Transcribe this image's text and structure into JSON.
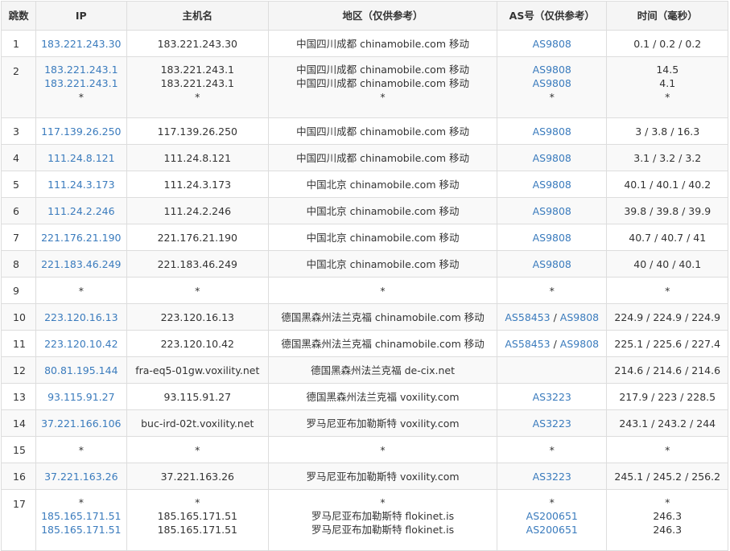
{
  "headers": [
    "跳数",
    "IP",
    "主机名",
    "地区（仅供参考）",
    "AS号（仅供参考）",
    "时间（毫秒）"
  ],
  "rows": [
    {
      "hop": "1",
      "ip": [
        "183.221.243.30"
      ],
      "host": [
        "183.221.243.30"
      ],
      "region": [
        "中国四川成都 chinamobile.com 移动"
      ],
      "as": [
        [
          "AS9808"
        ]
      ],
      "time": [
        "0.1 / 0.2 / 0.2"
      ]
    },
    {
      "hop": "2",
      "ip": [
        "183.221.243.1",
        "183.221.243.1",
        "*"
      ],
      "host": [
        "183.221.243.1",
        "183.221.243.1",
        "*"
      ],
      "region": [
        "中国四川成都 chinamobile.com 移动",
        "中国四川成都 chinamobile.com 移动",
        "*"
      ],
      "as": [
        [
          "AS9808"
        ],
        [
          "AS9808"
        ],
        [
          "*"
        ]
      ],
      "time": [
        "14.5",
        "4.1",
        "*"
      ]
    },
    {
      "hop": "3",
      "ip": [
        "117.139.26.250"
      ],
      "host": [
        "117.139.26.250"
      ],
      "region": [
        "中国四川成都 chinamobile.com 移动"
      ],
      "as": [
        [
          "AS9808"
        ]
      ],
      "time": [
        "3 / 3.8 / 16.3"
      ]
    },
    {
      "hop": "4",
      "ip": [
        "111.24.8.121"
      ],
      "host": [
        "111.24.8.121"
      ],
      "region": [
        "中国四川成都 chinamobile.com 移动"
      ],
      "as": [
        [
          "AS9808"
        ]
      ],
      "time": [
        "3.1 / 3.2 / 3.2"
      ]
    },
    {
      "hop": "5",
      "ip": [
        "111.24.3.173"
      ],
      "host": [
        "111.24.3.173"
      ],
      "region": [
        "中国北京 chinamobile.com 移动"
      ],
      "as": [
        [
          "AS9808"
        ]
      ],
      "time": [
        "40.1 / 40.1 / 40.2"
      ]
    },
    {
      "hop": "6",
      "ip": [
        "111.24.2.246"
      ],
      "host": [
        "111.24.2.246"
      ],
      "region": [
        "中国北京 chinamobile.com 移动"
      ],
      "as": [
        [
          "AS9808"
        ]
      ],
      "time": [
        "39.8 / 39.8 / 39.9"
      ]
    },
    {
      "hop": "7",
      "ip": [
        "221.176.21.190"
      ],
      "host": [
        "221.176.21.190"
      ],
      "region": [
        "中国北京 chinamobile.com 移动"
      ],
      "as": [
        [
          "AS9808"
        ]
      ],
      "time": [
        "40.7 / 40.7 / 41"
      ]
    },
    {
      "hop": "8",
      "ip": [
        "221.183.46.249"
      ],
      "host": [
        "221.183.46.249"
      ],
      "region": [
        "中国北京 chinamobile.com 移动"
      ],
      "as": [
        [
          "AS9808"
        ]
      ],
      "time": [
        "40 / 40 / 40.1"
      ]
    },
    {
      "hop": "9",
      "ip": [
        "*"
      ],
      "host": [
        "*"
      ],
      "region": [
        "*"
      ],
      "as": [
        [
          "*"
        ]
      ],
      "time": [
        "*"
      ]
    },
    {
      "hop": "10",
      "ip": [
        "223.120.16.13"
      ],
      "host": [
        "223.120.16.13"
      ],
      "region": [
        "德国黑森州法兰克福 chinamobile.com 移动"
      ],
      "as": [
        [
          "AS58453",
          "AS9808"
        ]
      ],
      "time": [
        "224.9 / 224.9 / 224.9"
      ]
    },
    {
      "hop": "11",
      "ip": [
        "223.120.10.42"
      ],
      "host": [
        "223.120.10.42"
      ],
      "region": [
        "德国黑森州法兰克福 chinamobile.com 移动"
      ],
      "as": [
        [
          "AS58453",
          "AS9808"
        ]
      ],
      "time": [
        "225.1 / 225.6 / 227.4"
      ]
    },
    {
      "hop": "12",
      "ip": [
        "80.81.195.144"
      ],
      "host": [
        "fra-eq5-01gw.voxility.net"
      ],
      "region": [
        "德国黑森州法兰克福 de-cix.net"
      ],
      "as": [
        []
      ],
      "time": [
        "214.6 / 214.6 / 214.6"
      ]
    },
    {
      "hop": "13",
      "ip": [
        "93.115.91.27"
      ],
      "host": [
        "93.115.91.27"
      ],
      "region": [
        "德国黑森州法兰克福 voxility.com"
      ],
      "as": [
        [
          "AS3223"
        ]
      ],
      "time": [
        "217.9 / 223 / 228.5"
      ]
    },
    {
      "hop": "14",
      "ip": [
        "37.221.166.106"
      ],
      "host": [
        "buc-ird-02t.voxility.net"
      ],
      "region": [
        "罗马尼亚布加勒斯特 voxility.com"
      ],
      "as": [
        [
          "AS3223"
        ]
      ],
      "time": [
        "243.1 / 243.2 / 244"
      ]
    },
    {
      "hop": "15",
      "ip": [
        "*"
      ],
      "host": [
        "*"
      ],
      "region": [
        "*"
      ],
      "as": [
        [
          "*"
        ]
      ],
      "time": [
        "*"
      ]
    },
    {
      "hop": "16",
      "ip": [
        "37.221.163.26"
      ],
      "host": [
        "37.221.163.26"
      ],
      "region": [
        "罗马尼亚布加勒斯特 voxility.com"
      ],
      "as": [
        [
          "AS3223"
        ]
      ],
      "time": [
        "245.1 / 245.2 / 256.2"
      ]
    },
    {
      "hop": "17",
      "ip": [
        "*",
        "185.165.171.51",
        "185.165.171.51"
      ],
      "host": [
        "*",
        "185.165.171.51",
        "185.165.171.51"
      ],
      "region": [
        "*",
        "罗马尼亚布加勒斯特 flokinet.is",
        "罗马尼亚布加勒斯特 flokinet.is"
      ],
      "as": [
        [
          "*"
        ],
        [
          "AS200651"
        ],
        [
          "AS200651"
        ]
      ],
      "time": [
        "*",
        "246.3",
        "246.3"
      ]
    }
  ],
  "colors": {
    "link": "#3a7bbd",
    "border": "#dddddd",
    "header_bg": "#f5f5f5",
    "alt_row_bg": "#f9f9f9",
    "text": "#333333"
  }
}
